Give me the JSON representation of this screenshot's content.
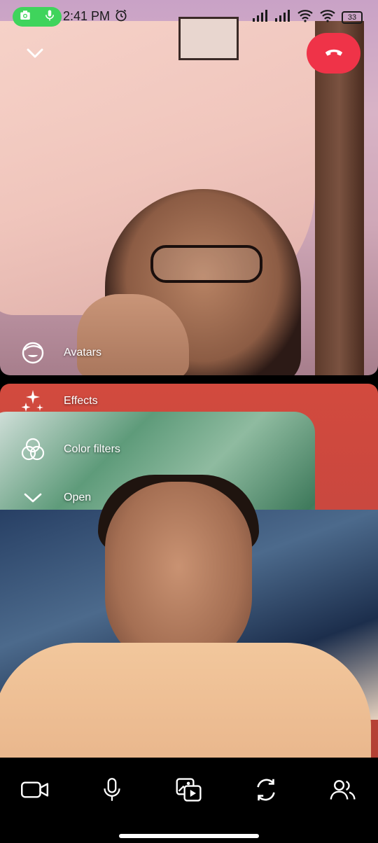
{
  "status_bar": {
    "time": "2:41 PM",
    "battery": "33",
    "pill_color": "#3fd45c"
  },
  "call": {
    "end_button_color": "#ef3348"
  },
  "effects_menu": {
    "items": [
      {
        "label": "Avatars",
        "icon": "avatar-icon"
      },
      {
        "label": "Effects",
        "icon": "sparkles-icon"
      },
      {
        "label": "Color filters",
        "icon": "color-filters-icon"
      },
      {
        "label": "Open",
        "icon": "chevron-down-icon"
      }
    ]
  },
  "toolbar": {
    "buttons": [
      {
        "icon": "video-camera-icon"
      },
      {
        "icon": "microphone-icon"
      },
      {
        "icon": "media-share-icon"
      },
      {
        "icon": "switch-camera-icon"
      },
      {
        "icon": "participants-icon"
      }
    ]
  }
}
